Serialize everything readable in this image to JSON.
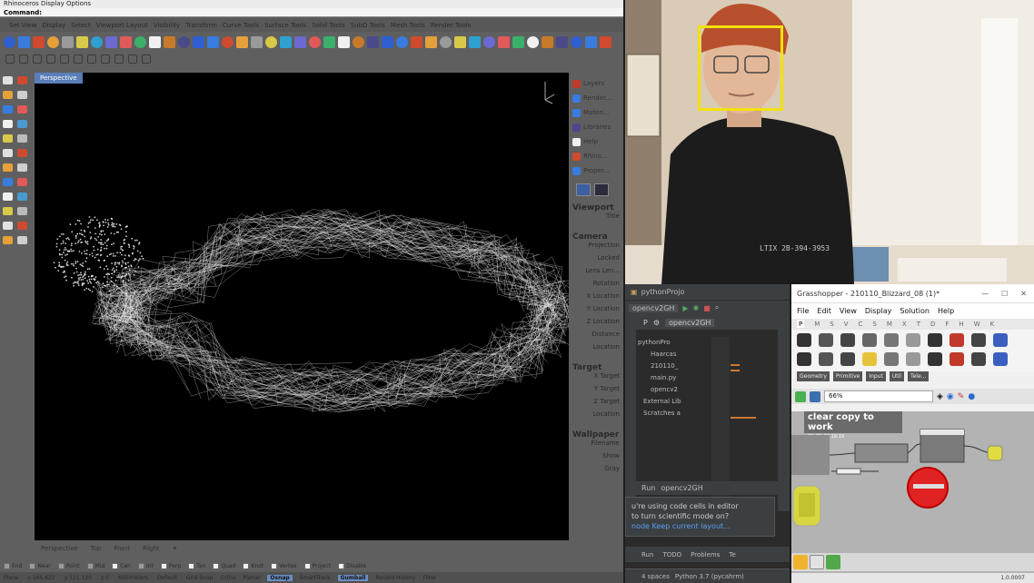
{
  "rhino": {
    "command_history": "Rhinoceros Display Options",
    "command_prompt": "Command:",
    "toolbar_tabs": [
      "Set View",
      "Display",
      "Select",
      "Viewport Layout",
      "Visibility",
      "Transform",
      "Curve Tools",
      "Surface Tools",
      "Solid Tools",
      "SubD Tools",
      "Mesh Tools",
      "Render Tools"
    ],
    "viewport_title": "Perspective",
    "view_tabs": [
      "Perspective",
      "Top",
      "Front",
      "Right"
    ],
    "panel_items": [
      "Layers",
      "Render...",
      "Materi...",
      "Libraries",
      "Help",
      "Rhino...",
      "Proper..."
    ],
    "panel_sections": {
      "viewport": {
        "title": "Viewport",
        "rows": [
          "Title"
        ]
      },
      "camera": {
        "title": "Camera",
        "rows": [
          "Projection",
          "Locked",
          "Lens Len...",
          "Rotation",
          "X Location",
          "Y Location",
          "Z Location",
          "Distance",
          "Location"
        ]
      },
      "target": {
        "title": "Target",
        "rows": [
          "X Target",
          "Y Target",
          "Z Target",
          "Location"
        ]
      },
      "wallpaper": {
        "title": "Wallpaper",
        "rows": [
          "Filename",
          "Show",
          "Gray"
        ]
      }
    },
    "osnaps": [
      {
        "label": "End",
        "on": true
      },
      {
        "label": "Near",
        "on": true
      },
      {
        "label": "Point",
        "on": true
      },
      {
        "label": "Mid",
        "on": true
      },
      {
        "label": "Cen",
        "on": false
      },
      {
        "label": "Int",
        "on": true
      },
      {
        "label": "Perp",
        "on": false
      },
      {
        "label": "Tan",
        "on": false
      },
      {
        "label": "Quad",
        "on": false
      },
      {
        "label": "Knot",
        "on": false
      },
      {
        "label": "Vertex",
        "on": false
      },
      {
        "label": "Project",
        "on": false
      },
      {
        "label": "Disable",
        "on": false
      }
    ],
    "status": {
      "plane": "Plane",
      "x": "x 165.622",
      "y": "y 121.120",
      "z": "z 0",
      "units": "Millimeters",
      "layer": "Default",
      "toggles": [
        "Grid Snap",
        "Ortho",
        "Planar",
        "Osnap",
        "SmartTrack",
        "Gumball",
        "Record History",
        "Filter"
      ],
      "active_toggles": [
        "Osnap",
        "Gumball"
      ]
    }
  },
  "pycharm": {
    "title": "pythonProjo",
    "config": "opencv2GH",
    "project_label": "P",
    "file_tab": "opencv2GH",
    "tree": [
      "pythonPro",
      "Haarcas",
      "210110_",
      "main.py",
      "opencv2",
      "External Lib",
      "Scratches a"
    ],
    "run_tab": "Run",
    "run_config": "opencv2GH",
    "notice_title": "u're using code cells in editor",
    "notice_body": "to turn scientific mode on?",
    "notice_links": [
      "node",
      "Keep current layout..."
    ],
    "bottom_tabs": [
      "Run",
      "TODO",
      "Problems",
      "Te"
    ],
    "status": [
      "4 spaces",
      "Python 3.7 (pycahrm)"
    ]
  },
  "grasshopper": {
    "title": "Grasshopper - 210110_Blizzard_08 (1)*",
    "menu": [
      "File",
      "Edit",
      "View",
      "Display",
      "Solution",
      "Help"
    ],
    "ribbon_tabs": [
      "P",
      "M",
      "S",
      "V",
      "C",
      "S",
      "M",
      "X",
      "T",
      "D",
      "F",
      "H",
      "W",
      "K"
    ],
    "categories": [
      "Geometry",
      "Primitive",
      "Input",
      "Util",
      "Tele..."
    ],
    "zoom": "66%",
    "group_title": "clear copy to work",
    "group_subtitle": "21_01_10 18:19",
    "version": "1.0.0007"
  },
  "webcam": {
    "shirt_text": "LTIX 2B-394-3953"
  }
}
